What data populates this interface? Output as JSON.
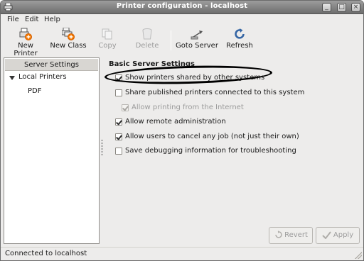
{
  "window": {
    "title": "Printer configuration - localhost"
  },
  "window_controls": {
    "minimize": "_",
    "maximize": "□",
    "close": "×"
  },
  "menubar": [
    {
      "label": "File"
    },
    {
      "label": "Edit"
    },
    {
      "label": "Help"
    }
  ],
  "toolbar": {
    "new_printer": "New Printer",
    "new_class": "New Class",
    "copy": "Copy",
    "delete": "Delete",
    "goto_server": "Goto Server",
    "refresh": "Refresh"
  },
  "tree": {
    "header": "Server Settings",
    "local_printers": "Local Printers",
    "printers": [
      "PDF"
    ]
  },
  "settings": {
    "section_title": "Basic Server Settings",
    "options": [
      {
        "label": "Show printers shared by other systems",
        "checked": true,
        "enabled": true
      },
      {
        "label": "Share published printers connected to this system",
        "checked": false,
        "enabled": true
      },
      {
        "label": "Allow printing from the Internet",
        "checked": true,
        "enabled": false
      },
      {
        "label": "Allow remote administration",
        "checked": true,
        "enabled": true
      },
      {
        "label": "Allow users to cancel any job (not just their own)",
        "checked": true,
        "enabled": true
      },
      {
        "label": "Save debugging information for troubleshooting",
        "checked": false,
        "enabled": true
      }
    ]
  },
  "buttons": {
    "revert": "Revert",
    "apply": "Apply"
  },
  "status": {
    "text": "Connected to localhost"
  },
  "colors": {
    "accent_blue": "#3465a4",
    "orange_badge": "#f57900"
  }
}
